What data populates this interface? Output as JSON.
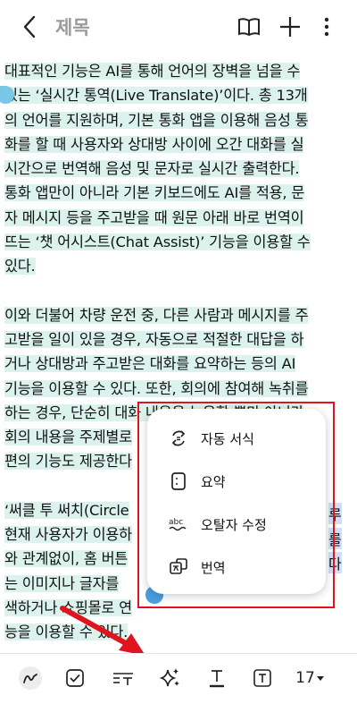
{
  "header": {
    "title": "제목"
  },
  "content": {
    "paragraphs": [
      [
        "대표적인 기능은 AI를 통해 언어의 장벽을 넘을 수",
        "있는 ‘실시간 통역(Live Translate)’이다. 총 13개",
        "의 언어를 지원하며, 기본 통화 앱을 이용해 음성 통",
        "화를 할 때 사용자와 상대방 사이에 오간 대화를 실",
        "시간으로 번역해 음성 및 문자로 실시간 출력한다.",
        "통화 앱만이 아니라 기본 키보드에도 AI를 적용, 문",
        "자 메시지 등을 주고받을 때 원문 아래 바로 번역이",
        "뜨는 ‘챗 어시스트(Chat Assist)’ 기능을 이용할 수",
        "있다."
      ],
      [
        "이와 더불어 차량 운전 중, 다른 사람과 메시지를 주",
        "고받을 일이 있을 경우, 자동으로 적절한 대답을 하",
        "거나 상대방과 주고받은 대화를 요약하는 등의 AI",
        "기능을 이용할 수 있다. 또한, 회의에 참여해 녹취를",
        "하는 경우, 단순히 대화 내용을 녹음할 뿐만 아니라",
        "회의 내용을 주제별로",
        "편의 기능도 제공한다"
      ],
      [
        "‘써클 투 써치(Circle",
        "현재 사용자가 이용하",
        "와 관계없이, 홈 버튼",
        "는 이미지나 글자를 ",
        "색하거나 쇼핑몰로 연",
        "능을 이용할 수 있다."
      ]
    ],
    "overflow_fragments": [
      "루",
      "를",
      "다"
    ]
  },
  "popup": {
    "items": [
      {
        "label": "자동 서식",
        "icon": "auto-format-icon"
      },
      {
        "label": "요약",
        "icon": "summary-icon"
      },
      {
        "label": "오탈자 수정",
        "icon": "spell-check-icon"
      },
      {
        "label": "번역",
        "icon": "translate-icon"
      }
    ]
  },
  "toolbar": {
    "font_size": "17"
  },
  "colors": {
    "highlight": "#dbf3ec",
    "annotation": "#e0141e",
    "handle": "#4a9fe0"
  }
}
